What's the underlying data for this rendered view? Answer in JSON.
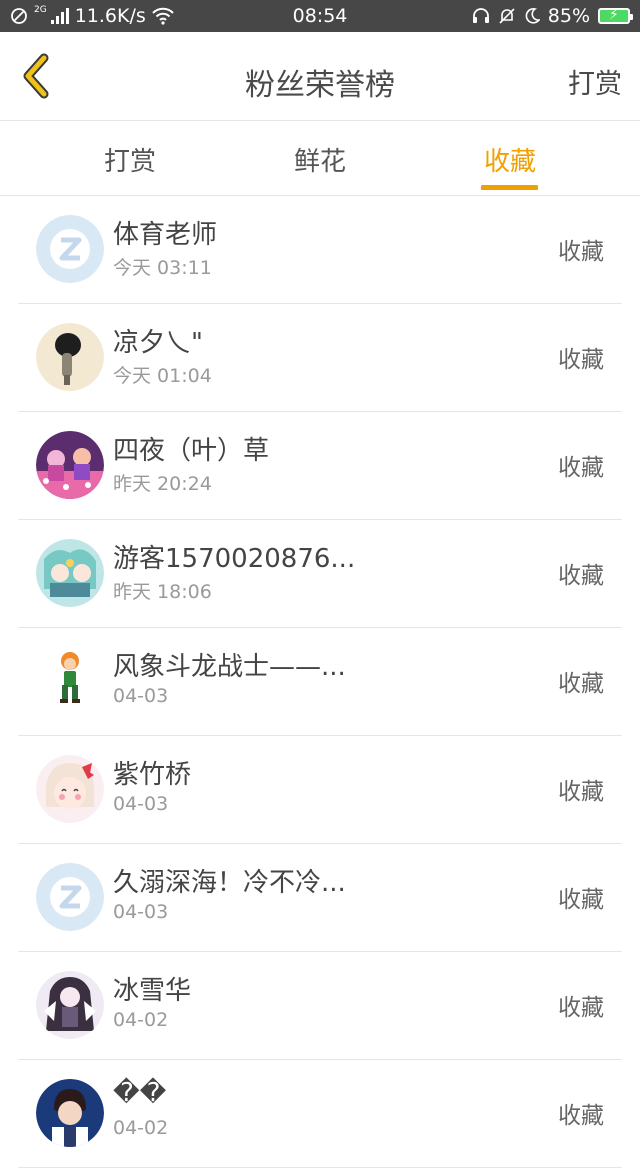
{
  "status_bar": {
    "network_speed": "11.6K/s",
    "network_type": "2G",
    "time": "08:54",
    "battery": "85%",
    "battery_color": "#4cd964"
  },
  "header": {
    "back_icon": "chevron-left-icon",
    "title": "粉丝荣誉榜",
    "action": "打赏",
    "back_color": "#f0b400"
  },
  "tabs": [
    {
      "label": "打赏",
      "active": false
    },
    {
      "label": "鲜花",
      "active": false
    },
    {
      "label": "收藏",
      "active": true
    }
  ],
  "accent_color": "#f0a000",
  "list": [
    {
      "name": "体育老师",
      "time": "今天 03:11",
      "label": "收藏",
      "avatar": "default-z"
    },
    {
      "name": "凉夕乀\"",
      "time": "今天 01:04",
      "label": "收藏",
      "avatar": "photo-girl-sketch"
    },
    {
      "name": "四夜（叶）草",
      "time": "昨天 20:24",
      "label": "收藏",
      "avatar": "anime-pink"
    },
    {
      "name": "游客1570020876...",
      "time": "昨天 18:06",
      "label": "收藏",
      "avatar": "anime-teal"
    },
    {
      "name": "风象斗龙战士——...",
      "time": "04-03",
      "label": "收藏",
      "avatar": "cartoon-figure"
    },
    {
      "name": "紫竹桥",
      "time": "04-03",
      "label": "收藏",
      "avatar": "anime-bow-girl"
    },
    {
      "name": "久溺深海！冷不冷...",
      "time": "04-03",
      "label": "收藏",
      "avatar": "default-z"
    },
    {
      "name": "冰雪华",
      "time": "04-02",
      "label": "收藏",
      "avatar": "anime-dark-hair"
    },
    {
      "name": "��",
      "time": "04-02",
      "label": "收藏",
      "avatar": "photo-boy"
    }
  ]
}
